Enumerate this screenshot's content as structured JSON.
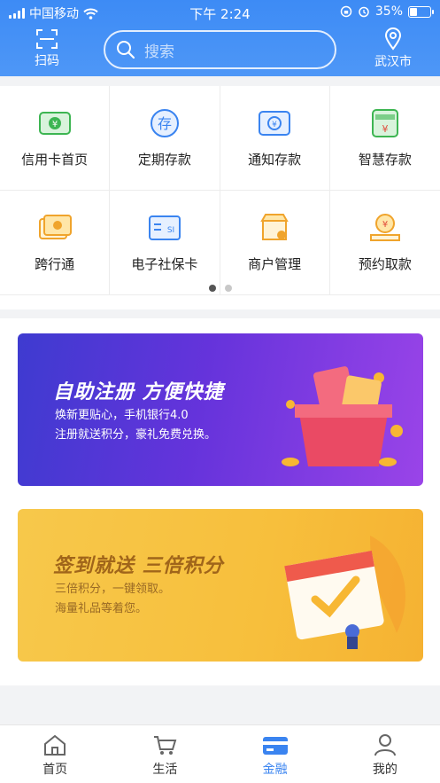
{
  "status_bar": {
    "carrier": "中国移动",
    "time": "下午 2:24",
    "battery": "35%",
    "battery_level": 0.35
  },
  "header": {
    "scan_label": "扫码",
    "search_placeholder": "搜索",
    "location_label": "武汉市"
  },
  "grid": {
    "items": [
      {
        "label": "信用卡首页",
        "icon": "credit-card-icon"
      },
      {
        "label": "定期存款",
        "icon": "deposit-icon"
      },
      {
        "label": "通知存款",
        "icon": "notice-deposit-icon"
      },
      {
        "label": "智慧存款",
        "icon": "smart-deposit-icon"
      },
      {
        "label": "跨行通",
        "icon": "interbank-icon"
      },
      {
        "label": "电子社保卡",
        "icon": "social-security-card-icon"
      },
      {
        "label": "商户管理",
        "icon": "merchant-icon"
      },
      {
        "label": "预约取款",
        "icon": "appointment-withdraw-icon"
      }
    ],
    "page_count": 2,
    "current_page": 1
  },
  "banners": [
    {
      "title": "自助注册  方便快捷",
      "line1": "焕新更贴心，手机银行4.0",
      "line2": "注册就送积分，豪礼免费兑换。"
    },
    {
      "title": "签到就送  三倍积分",
      "line1": "三倍积分，一键领取。",
      "line2": "海量礼品等着您。"
    }
  ],
  "tabbar": {
    "tabs": [
      {
        "label": "首页",
        "icon": "home-icon"
      },
      {
        "label": "生活",
        "icon": "cart-icon"
      },
      {
        "label": "金融",
        "icon": "card-icon",
        "active": true
      },
      {
        "label": "我的",
        "icon": "user-icon"
      }
    ]
  },
  "colors": {
    "primary": "#3d8bf5",
    "active_tab": "#3a84f0"
  }
}
